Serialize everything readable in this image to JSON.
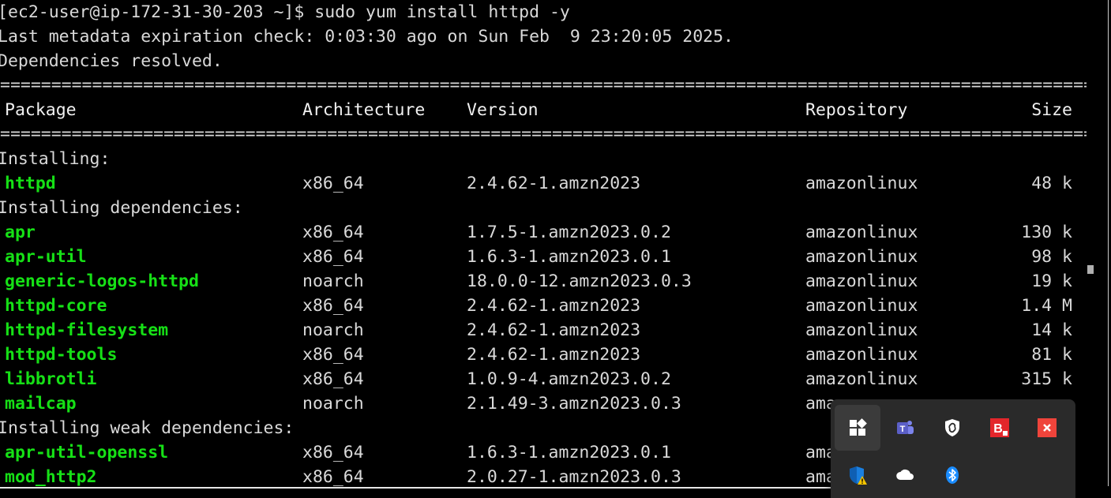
{
  "terminal": {
    "command_line": "[ec2-user@ip-172-31-30-203 ~]$ sudo yum install httpd -y",
    "metadata_line": "Last metadata expiration check: 0:03:30 ago on Sun Feb  9 23:20:05 2025.",
    "deps_resolved": "Dependencies resolved.",
    "rule": "================================================================================================================================",
    "headers": {
      "package": "Package",
      "arch": "Architecture",
      "version": "Version",
      "repo": "Repository",
      "size": "Size"
    },
    "section_installing": "Installing:",
    "section_deps": "Installing dependencies:",
    "section_weak": "Installing weak dependencies:",
    "installing": [
      {
        "name": "httpd",
        "arch": "x86_64",
        "version": "2.4.62-1.amzn2023",
        "repo": "amazonlinux",
        "size": "48 k"
      }
    ],
    "dependencies": [
      {
        "name": "apr",
        "arch": "x86_64",
        "version": "1.7.5-1.amzn2023.0.2",
        "repo": "amazonlinux",
        "size": "130 k"
      },
      {
        "name": "apr-util",
        "arch": "x86_64",
        "version": "1.6.3-1.amzn2023.0.1",
        "repo": "amazonlinux",
        "size": "98 k"
      },
      {
        "name": "generic-logos-httpd",
        "arch": "noarch",
        "version": "18.0.0-12.amzn2023.0.3",
        "repo": "amazonlinux",
        "size": "19 k"
      },
      {
        "name": "httpd-core",
        "arch": "x86_64",
        "version": "2.4.62-1.amzn2023",
        "repo": "amazonlinux",
        "size": "1.4 M"
      },
      {
        "name": "httpd-filesystem",
        "arch": "noarch",
        "version": "2.4.62-1.amzn2023",
        "repo": "amazonlinux",
        "size": "14 k"
      },
      {
        "name": "httpd-tools",
        "arch": "x86_64",
        "version": "2.4.62-1.amzn2023",
        "repo": "amazonlinux",
        "size": "81 k"
      },
      {
        "name": "libbrotli",
        "arch": "x86_64",
        "version": "1.0.9-4.amzn2023.0.2",
        "repo": "amazonlinux",
        "size": "315 k"
      },
      {
        "name": "mailcap",
        "arch": "noarch",
        "version": "2.1.49-3.amzn2023.0.3",
        "repo": "ama",
        "size": ""
      }
    ],
    "weak_dependencies": [
      {
        "name": "apr-util-openssl",
        "arch": "x86_64",
        "version": "1.6.3-1.amzn2023.0.1",
        "repo": "ama",
        "size": ""
      },
      {
        "name": "mod_http2",
        "arch": "x86_64",
        "version": "2.0.27-1.amzn2023.0.3",
        "repo": "ama",
        "size": ""
      }
    ],
    "colors": {
      "package_name": "#16e016",
      "text": "#d9d9d9",
      "background": "#000000"
    }
  },
  "tray_overflow": {
    "icons": [
      {
        "name": "app-grid-icon"
      },
      {
        "name": "teams-icon"
      },
      {
        "name": "vpn-shield-icon"
      },
      {
        "name": "bitdefender-icon"
      },
      {
        "name": "anydesk-icon"
      },
      {
        "name": "windows-security-warning-icon"
      },
      {
        "name": "onedrive-icon"
      },
      {
        "name": "bluetooth-icon"
      }
    ],
    "colors": {
      "background": "#2a2a2a",
      "teams": "#5b5fc7",
      "bluetooth": "#1a8cff",
      "red": "#e3262b"
    }
  }
}
